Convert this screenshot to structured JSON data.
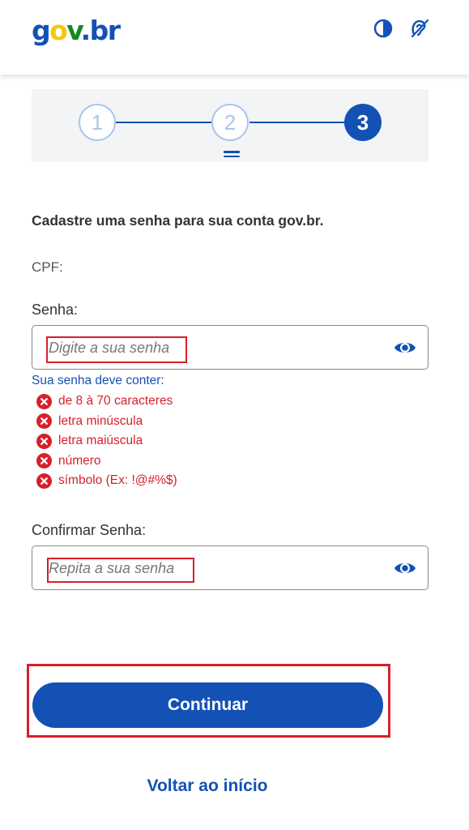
{
  "header": {
    "logo": {
      "g": "g",
      "o": "o",
      "v": "v",
      "dot": ".",
      "b": "b",
      "r": "r"
    },
    "icons": [
      "contrast-icon",
      "accessibility-icon"
    ]
  },
  "stepper": {
    "steps": [
      {
        "number": "1",
        "state": "completed"
      },
      {
        "number": "2",
        "state": "completed"
      },
      {
        "number": "3",
        "state": "current"
      }
    ]
  },
  "form": {
    "title": "Cadastre uma senha para sua conta gov.br.",
    "cpf_label": "CPF:",
    "password": {
      "label": "Senha:",
      "placeholder": "Digite a sua senha",
      "value": ""
    },
    "rules_title": "Sua senha deve conter:",
    "rules": [
      "de 8 à 70 caracteres",
      "letra minúscula",
      "letra maiúscula",
      "número",
      "símbolo (Ex: !@#%$)"
    ],
    "confirm": {
      "label": "Confirmar Senha:",
      "placeholder": "Repita a sua senha",
      "value": ""
    },
    "continue_label": "Continuar",
    "back_label": "Voltar ao início"
  },
  "colors": {
    "primary": "#1351b4",
    "error": "#d81f2a",
    "step_inactive": "#a9c6ee",
    "highlight": "#d81f2a"
  }
}
